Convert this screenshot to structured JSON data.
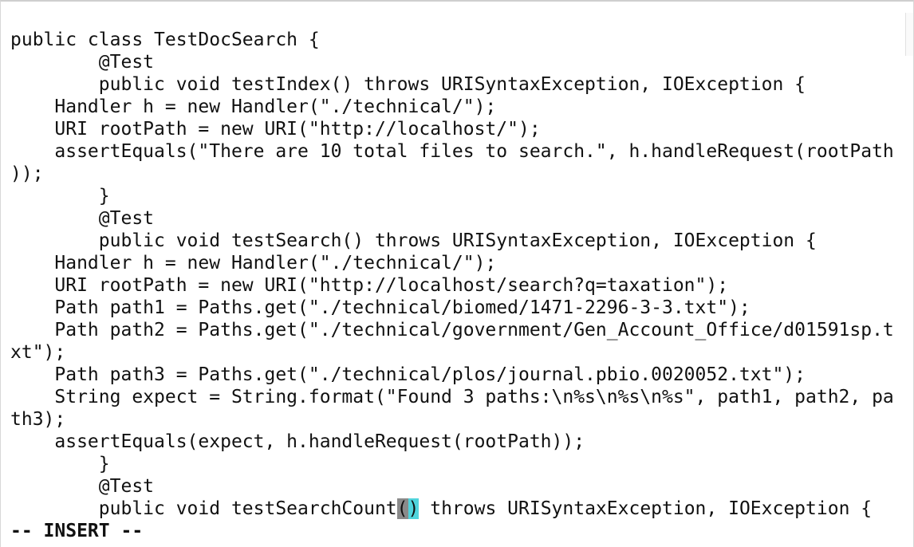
{
  "editor": {
    "lines": [
      "public class TestDocSearch {",
      "        @Test",
      "        public void testIndex() throws URISyntaxException, IOException {",
      "    Handler h = new Handler(\"./technical/\");",
      "    URI rootPath = new URI(\"http://localhost/\");",
      "    assertEquals(\"There are 10 total files to search.\", h.handleRequest(rootPath",
      "));",
      "        }",
      "        @Test",
      "        public void testSearch() throws URISyntaxException, IOException {",
      "    Handler h = new Handler(\"./technical/\");",
      "    URI rootPath = new URI(\"http://localhost/search?q=taxation\");",
      "    Path path1 = Paths.get(\"./technical/biomed/1471-2296-3-3.txt\");",
      "    Path path2 = Paths.get(\"./technical/government/Gen_Account_Office/d01591sp.t",
      "xt\");",
      "    Path path3 = Paths.get(\"./technical/plos/journal.pbio.0020052.txt\");",
      "    String expect = String.format(\"Found 3 paths:\\n%s\\n%s\\n%s\", path1, path2, pa",
      "th3);",
      "    assertEquals(expect, h.handleRequest(rootPath));",
      "        }",
      "        @Test"
    ],
    "cursor_line": {
      "before": "        public void testSearchCount",
      "paren_open": "(",
      "paren_close": ")",
      "after": " throws URISyntaxException, IOException {"
    },
    "mode": "-- INSERT --"
  }
}
